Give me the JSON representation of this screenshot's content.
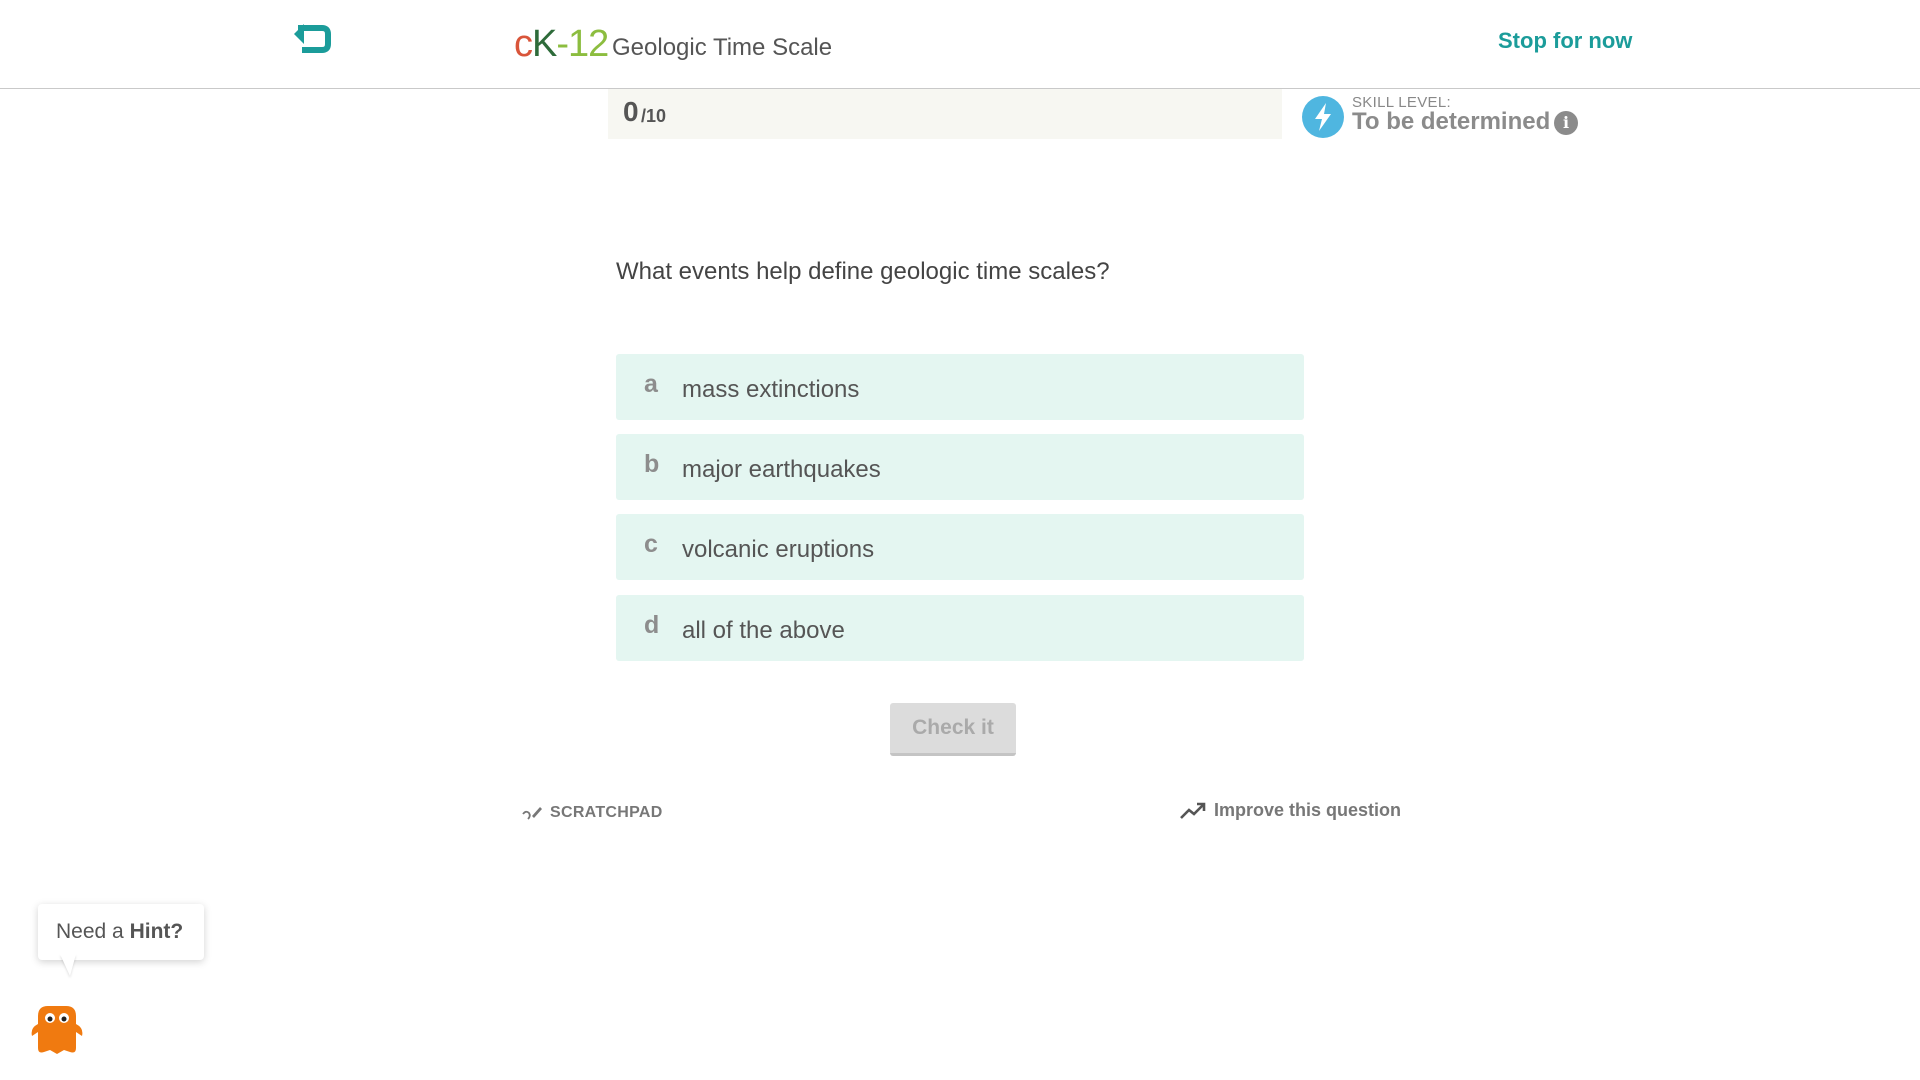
{
  "header": {
    "logo": {
      "c": "c",
      "k": "K",
      "rest": "-12"
    },
    "title": "Geologic Time Scale",
    "stop_label": "Stop for now"
  },
  "score": {
    "current": "0",
    "total": "/10"
  },
  "skill": {
    "label": "SKILL LEVEL:",
    "value": "To be determined",
    "info_glyph": "i"
  },
  "question": {
    "text": "What events help define geologic time scales?"
  },
  "options": [
    {
      "letter": "a",
      "text": "mass extinctions"
    },
    {
      "letter": "b",
      "text": "major earthquakes"
    },
    {
      "letter": "c",
      "text": "volcanic eruptions"
    },
    {
      "letter": "d",
      "text": "all of the above"
    }
  ],
  "check_label": "Check it",
  "footer": {
    "scratchpad_label": "SCRATCHPAD",
    "improve_label": "Improve this question"
  },
  "hint": {
    "prefix": "Need a ",
    "bold": "Hint?"
  },
  "colors": {
    "accent": "#1b9c9a",
    "option_bg": "#e4f6f1",
    "skill_icon": "#4fb6e0",
    "mascot": "#f07a10"
  }
}
